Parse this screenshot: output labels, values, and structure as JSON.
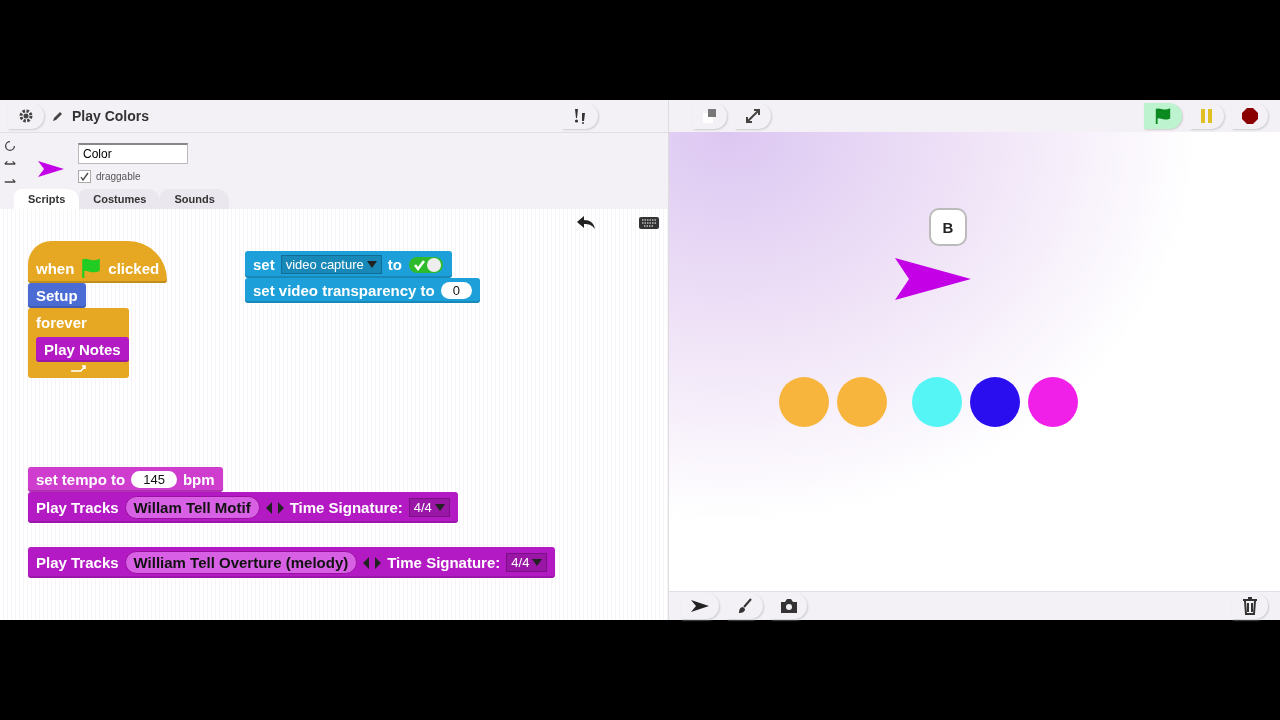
{
  "project": {
    "title": "Play Colors"
  },
  "sprite": {
    "name": "Color",
    "draggable": true,
    "draggable_label": "draggable"
  },
  "tabs": [
    {
      "label": "Scripts",
      "selected": true
    },
    {
      "label": "Costumes",
      "selected": false
    },
    {
      "label": "Sounds",
      "selected": false
    }
  ],
  "scripts": [
    {
      "blocks": [
        {
          "kind": "hat",
          "color": "#e6a822",
          "parts": [
            {
              "kind": "label",
              "text": "when"
            },
            {
              "kind": "flag"
            },
            {
              "kind": "label",
              "text": "clicked"
            }
          ]
        },
        {
          "kind": "command",
          "color": "#4a6cd4",
          "parts": [
            {
              "kind": "label",
              "text": "Setup"
            }
          ]
        },
        {
          "kind": "c",
          "color": "#e6a822",
          "parts": [
            {
              "kind": "label",
              "text": "forever"
            }
          ],
          "children": [
            {
              "kind": "command",
              "color": "#b41ac4",
              "parts": [
                {
                  "kind": "label",
                  "text": "Play Notes"
                }
              ]
            }
          ]
        }
      ]
    },
    {
      "blocks": [
        {
          "kind": "command",
          "color": "#1da0da",
          "parts": [
            {
              "kind": "label",
              "text": "set"
            },
            {
              "kind": "dropdown",
              "text": "video capture"
            },
            {
              "kind": "label",
              "text": "to"
            },
            {
              "kind": "toggle",
              "on": true
            }
          ]
        },
        {
          "kind": "command",
          "color": "#1da0da",
          "parts": [
            {
              "kind": "label",
              "text": "set video transparency to"
            },
            {
              "kind": "number",
              "text": "0"
            }
          ]
        }
      ]
    },
    {
      "blocks": [
        {
          "kind": "command",
          "color": "#cf3dcf",
          "parts": [
            {
              "kind": "label",
              "text": "set tempo to"
            },
            {
              "kind": "number",
              "text": "145"
            },
            {
              "kind": "label",
              "text": "bpm"
            }
          ]
        },
        {
          "kind": "command",
          "color": "#b41ac4",
          "parts": [
            {
              "kind": "label",
              "text": "Play Tracks"
            },
            {
              "kind": "reporter",
              "text": "Willam Tell Motif"
            },
            {
              "kind": "arrows"
            },
            {
              "kind": "label",
              "text": "Time Signature:"
            },
            {
              "kind": "dropdown",
              "text": "4/4"
            }
          ]
        }
      ]
    },
    {
      "blocks": [
        {
          "kind": "command",
          "color": "#b41ac4",
          "parts": [
            {
              "kind": "label",
              "text": "Play Tracks"
            },
            {
              "kind": "reporter",
              "text": "William Tell Overture (melody)"
            },
            {
              "kind": "arrows"
            },
            {
              "kind": "label",
              "text": "Time Signature:"
            },
            {
              "kind": "dropdown",
              "text": "4/4"
            }
          ]
        }
      ]
    }
  ],
  "stage": {
    "flag_active": true,
    "speech": "B",
    "dots": [
      {
        "color": "#f7b53e"
      },
      {
        "color": "#f7b53e"
      },
      {
        "color": "#55f5f5"
      },
      {
        "color": "#2a0ef0"
      },
      {
        "color": "#f020e8"
      }
    ]
  }
}
